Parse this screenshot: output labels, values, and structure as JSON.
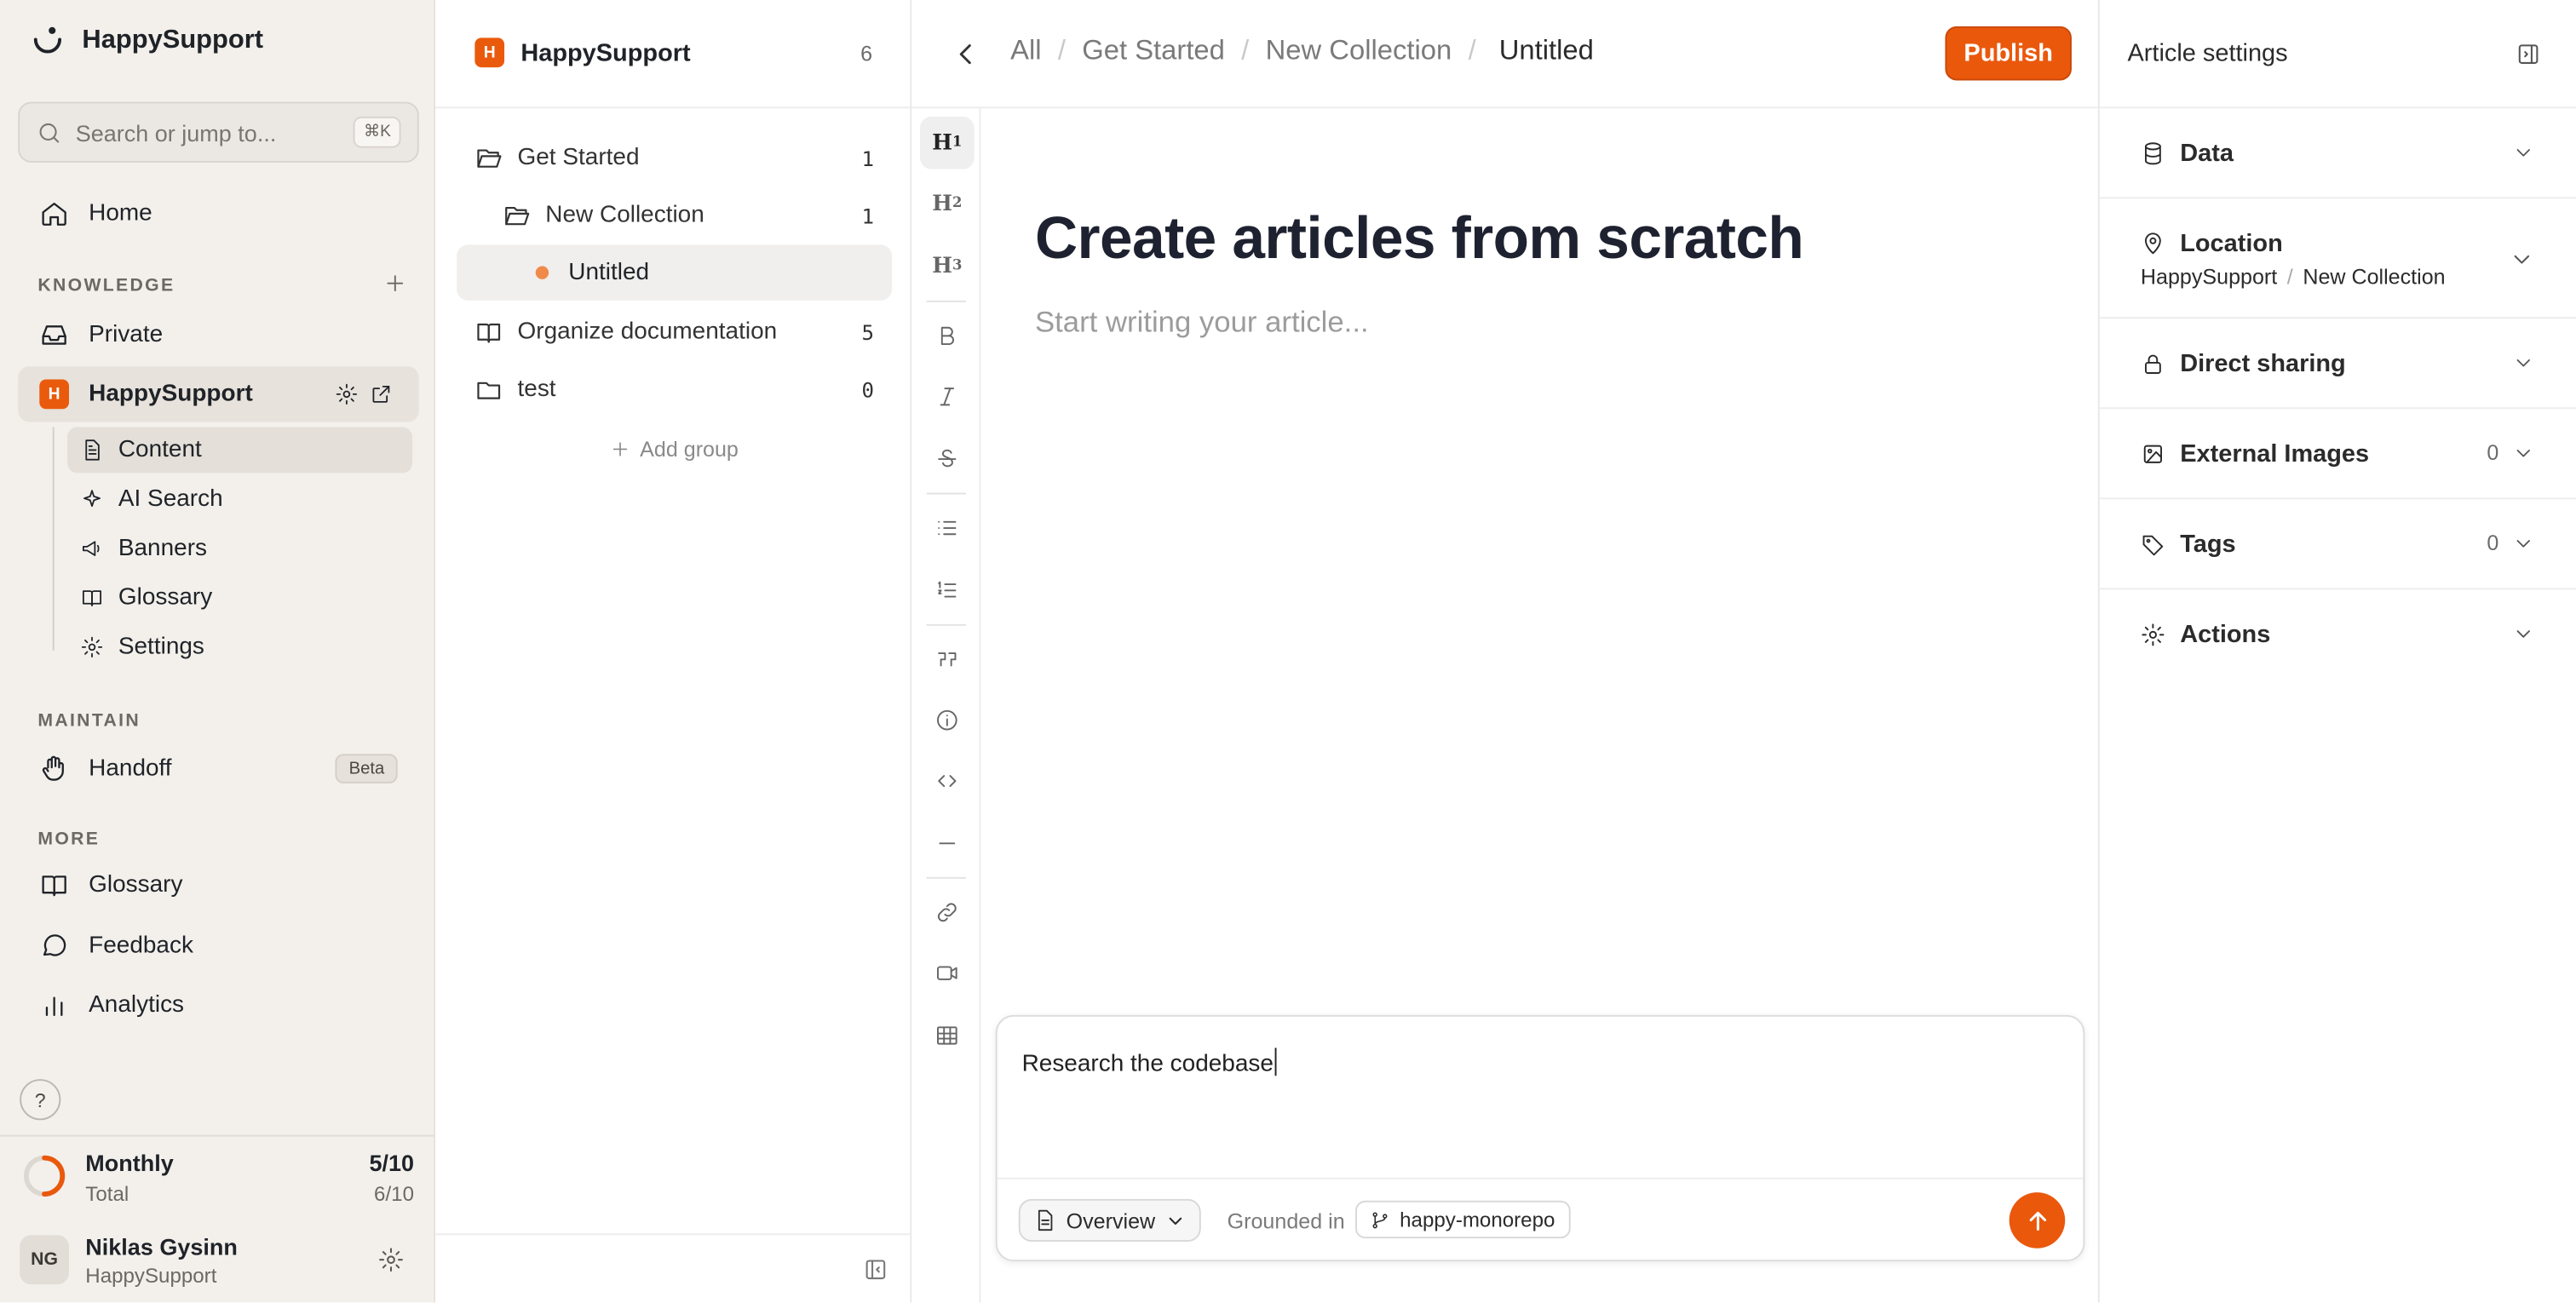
{
  "sidebar": {
    "brand": "HappySupport",
    "search": {
      "placeholder": "Search or jump to...",
      "shortcut": "⌘K"
    },
    "home": "Home",
    "knowledge_label": "KNOWLEDGE",
    "private": "Private",
    "workspace": {
      "badge": "H",
      "name": "HappySupport"
    },
    "sub_items": [
      "Content",
      "AI Search",
      "Banners",
      "Glossary",
      "Settings"
    ],
    "maintain_label": "MAINTAIN",
    "handoff": {
      "label": "Handoff",
      "badge": "Beta"
    },
    "more_label": "MORE",
    "more_items": [
      "Glossary",
      "Feedback",
      "Analytics"
    ],
    "help": "?",
    "usage": {
      "title": "Monthly",
      "subtitle": "Total",
      "primary": "5/10",
      "secondary": "6/10",
      "progress": 0.5
    },
    "user": {
      "initials": "NG",
      "name": "Niklas Gysinn",
      "org": "HappySupport"
    }
  },
  "tree": {
    "title": "HappySupport",
    "badge": "H",
    "count": "6",
    "items": [
      {
        "label": "Get Started",
        "count": "1"
      },
      {
        "label": "New Collection",
        "count": "1"
      },
      {
        "label": "Untitled"
      },
      {
        "label": "Organize documentation",
        "count": "5"
      },
      {
        "label": "test",
        "count": "0"
      }
    ],
    "add_group": "Add group"
  },
  "editor": {
    "breadcrumbs": [
      "All",
      "Get Started",
      "New Collection",
      "Untitled"
    ],
    "publish": "Publish",
    "toolbar": {
      "h1": "H",
      "h2": "H",
      "h3": "H",
      "h1_sub": "1",
      "h2_sub": "2",
      "h3_sub": "3"
    },
    "title": "Create articles from scratch",
    "placeholder": "Start writing your article...",
    "prompt": {
      "text": "Research the codebase",
      "mode": "Overview",
      "grounded_label": "Grounded in",
      "repo": "happy-monorepo"
    }
  },
  "settings": {
    "title": "Article settings",
    "sections": [
      {
        "label": "Data"
      },
      {
        "label": "Location",
        "path": [
          "HappySupport",
          "New Collection"
        ]
      },
      {
        "label": "Direct sharing"
      },
      {
        "label": "External Images",
        "count": "0"
      },
      {
        "label": "Tags",
        "count": "0"
      },
      {
        "label": "Actions"
      }
    ]
  },
  "colors": {
    "accent": "#ea580c",
    "sidebar_bg": "#f3f0ec"
  }
}
